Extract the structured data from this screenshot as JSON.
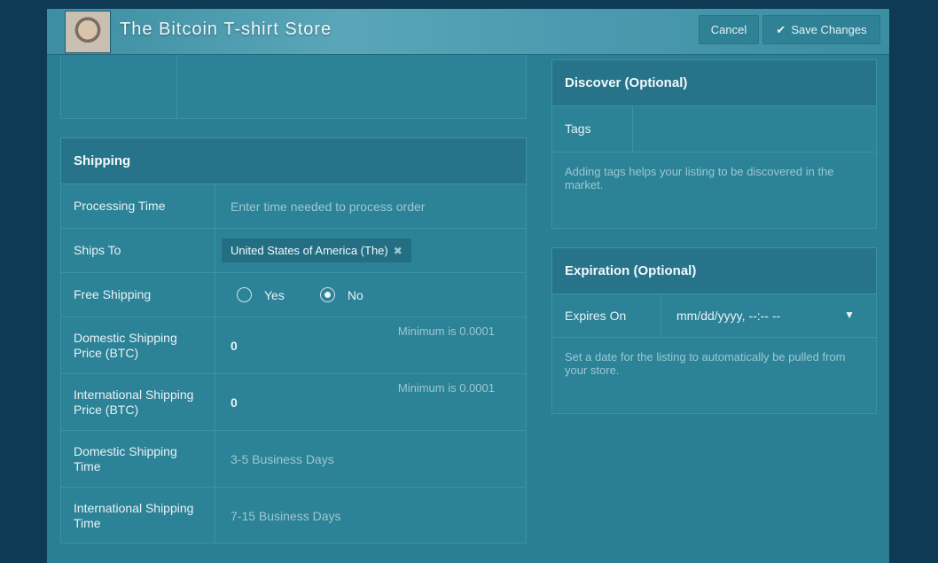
{
  "header": {
    "title": "The Bitcoin T-shirt Store",
    "cancel_label": "Cancel",
    "save_label": "Save Changes",
    "save_icon": "check-icon"
  },
  "shipping": {
    "title": "Shipping",
    "rows": {
      "processing_time": {
        "label": "Processing Time",
        "placeholder": "Enter time needed to process order"
      },
      "ships_to": {
        "label": "Ships To",
        "tag": "United States of America (The)",
        "remove_icon": "close-icon"
      },
      "free_shipping": {
        "label": "Free Shipping",
        "option_yes": "Yes",
        "option_no": "No",
        "selected": "No"
      },
      "domestic_price": {
        "label": "Domestic Shipping Price (BTC)",
        "value": "0",
        "hint": "Minimum is 0.0001"
      },
      "international_price": {
        "label": "International Shipping Price (BTC)",
        "value": "0",
        "hint": "Minimum is 0.0001"
      },
      "domestic_time": {
        "label": "Domestic Shipping Time",
        "placeholder": "3-5 Business Days"
      },
      "international_time": {
        "label": "International Shipping Time",
        "placeholder": "7-15 Business Days"
      }
    }
  },
  "discover": {
    "title": "Discover (Optional)",
    "tags_label": "Tags",
    "description": "Adding tags helps your listing to be discovered in the market."
  },
  "expiration": {
    "title": "Expiration (Optional)",
    "expires_label": "Expires On",
    "date_value": "mm/dd/yyyy, --:-- --",
    "dropdown_icon": "triangle-down-icon",
    "description": "Set a date for the listing to automatically be pulled from your store."
  }
}
